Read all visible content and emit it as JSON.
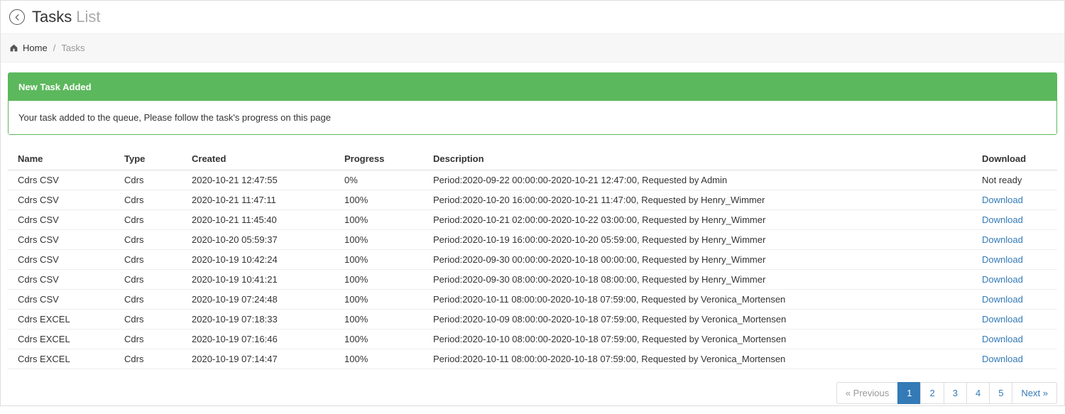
{
  "header": {
    "title_main": "Tasks",
    "title_sub": "List"
  },
  "breadcrumb": {
    "home_label": "Home",
    "current_label": "Tasks",
    "sep": "/"
  },
  "alert": {
    "title": "New Task Added",
    "message": "Your task added to the queue, Please follow the task's progress on this page"
  },
  "table": {
    "columns": {
      "name": "Name",
      "type": "Type",
      "created": "Created",
      "progress": "Progress",
      "description": "Description",
      "download": "Download"
    },
    "download_label": "Download",
    "not_ready_label": "Not ready",
    "rows": [
      {
        "name": "Cdrs CSV",
        "type": "Cdrs",
        "created": "2020-10-21 12:47:55",
        "progress": "0%",
        "description": "Period:2020-09-22 00:00:00-2020-10-21 12:47:00, Requested by  Admin",
        "ready": false
      },
      {
        "name": "Cdrs CSV",
        "type": "Cdrs",
        "created": "2020-10-21 11:47:11",
        "progress": "100%",
        "description": "Period:2020-10-20 16:00:00-2020-10-21 11:47:00, Requested by  Henry_Wimmer",
        "ready": true
      },
      {
        "name": "Cdrs CSV",
        "type": "Cdrs",
        "created": "2020-10-21 11:45:40",
        "progress": "100%",
        "description": "Period:2020-10-21 02:00:00-2020-10-22 03:00:00, Requested by  Henry_Wimmer",
        "ready": true
      },
      {
        "name": "Cdrs CSV",
        "type": "Cdrs",
        "created": "2020-10-20 05:59:37",
        "progress": "100%",
        "description": "Period:2020-10-19 16:00:00-2020-10-20 05:59:00, Requested by  Henry_Wimmer",
        "ready": true
      },
      {
        "name": "Cdrs CSV",
        "type": "Cdrs",
        "created": "2020-10-19 10:42:24",
        "progress": "100%",
        "description": "Period:2020-09-30 00:00:00-2020-10-18 00:00:00, Requested by  Henry_Wimmer",
        "ready": true
      },
      {
        "name": "Cdrs CSV",
        "type": "Cdrs",
        "created": "2020-10-19 10:41:21",
        "progress": "100%",
        "description": "Period:2020-09-30 08:00:00-2020-10-18 08:00:00, Requested by  Henry_Wimmer",
        "ready": true
      },
      {
        "name": "Cdrs CSV",
        "type": "Cdrs",
        "created": "2020-10-19 07:24:48",
        "progress": "100%",
        "description": "Period:2020-10-11 08:00:00-2020-10-18 07:59:00, Requested by  Veronica_Mortensen",
        "ready": true
      },
      {
        "name": "Cdrs EXCEL",
        "type": "Cdrs",
        "created": "2020-10-19 07:18:33",
        "progress": "100%",
        "description": "Period:2020-10-09 08:00:00-2020-10-18 07:59:00, Requested by  Veronica_Mortensen",
        "ready": true
      },
      {
        "name": "Cdrs EXCEL",
        "type": "Cdrs",
        "created": "2020-10-19 07:16:46",
        "progress": "100%",
        "description": "Period:2020-10-10 08:00:00-2020-10-18 07:59:00, Requested by  Veronica_Mortensen",
        "ready": true
      },
      {
        "name": "Cdrs EXCEL",
        "type": "Cdrs",
        "created": "2020-10-19 07:14:47",
        "progress": "100%",
        "description": "Period:2020-10-11 08:00:00-2020-10-18 07:59:00, Requested by  Veronica_Mortensen",
        "ready": true
      }
    ]
  },
  "pagination": {
    "prev_label": "« Previous",
    "next_label": "Next »",
    "pages": [
      "1",
      "2",
      "3",
      "4",
      "5"
    ],
    "current": "1"
  }
}
